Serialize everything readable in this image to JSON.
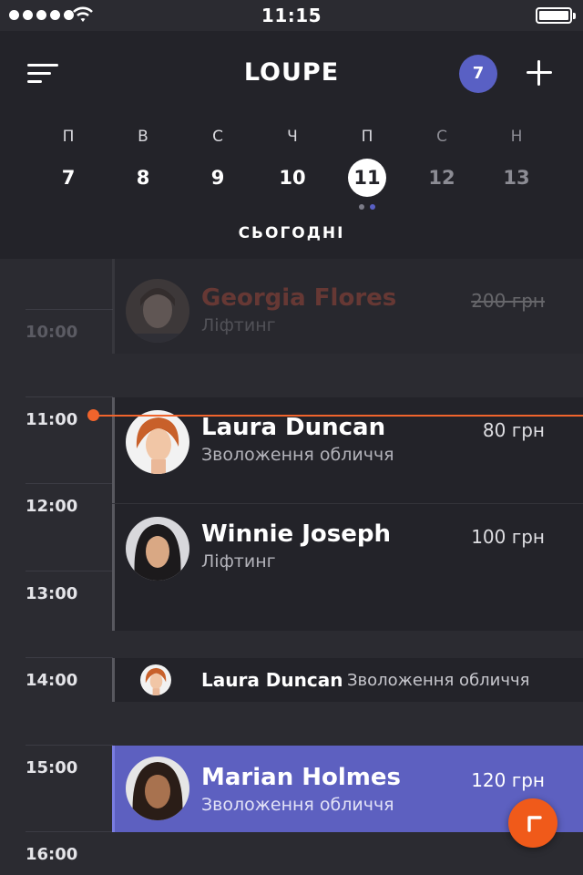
{
  "status_bar": {
    "time": "11:15",
    "signal_icon": "signal-dots-icon",
    "wifi_icon": "wifi-icon",
    "battery_icon": "battery-icon",
    "battery_level": 1.0
  },
  "header": {
    "title": "LOUPE",
    "menu_icon": "sort-menu-icon",
    "notification_count": "7",
    "add_icon": "plus-icon",
    "accent_color": "#5960c4"
  },
  "week": {
    "days": [
      {
        "weekday": "П",
        "date": "7"
      },
      {
        "weekday": "В",
        "date": "8"
      },
      {
        "weekday": "С",
        "date": "9"
      },
      {
        "weekday": "Ч",
        "date": "10"
      },
      {
        "weekday": "П",
        "date": "11",
        "selected": true
      },
      {
        "weekday": "С",
        "date": "12",
        "weekend": true
      },
      {
        "weekday": "Н",
        "date": "13",
        "weekend": true
      }
    ],
    "today_label": "СЬОГОДНІ"
  },
  "timeline": {
    "hours": [
      "10:00",
      "11:00",
      "12:00",
      "13:00",
      "14:00",
      "15:00",
      "16:00"
    ],
    "now_color": "#f0642c",
    "appointments": [
      {
        "name": "Georgia Flores",
        "service": "Ліфтинг",
        "price": "200 грн",
        "status": "past"
      },
      {
        "name": "Laura Duncan",
        "service": "Зволоження обличчя",
        "price": "80 грн"
      },
      {
        "name": "Winnie Joseph",
        "service": "Ліфтинг",
        "price": "100 грн"
      },
      {
        "name": "Laura Duncan",
        "service": "Зволоження обличчя"
      },
      {
        "name": "Marian Holmes",
        "service": "Зволоження обличчя",
        "price": "120 грн",
        "highlight_color": "#5d60c0"
      }
    ]
  },
  "fab": {
    "icon": "corner-arrow-icon",
    "color": "#f05a1a"
  }
}
